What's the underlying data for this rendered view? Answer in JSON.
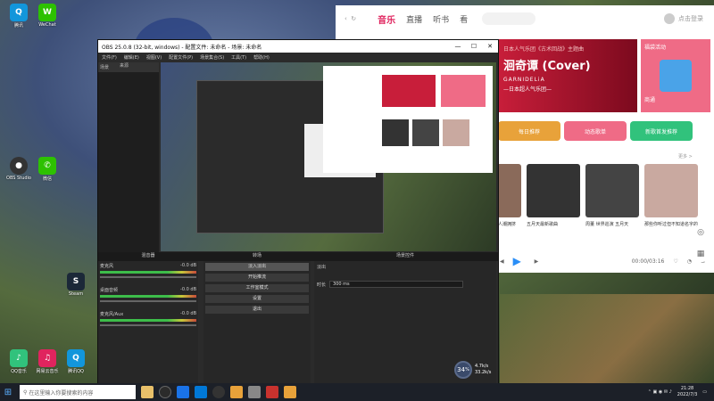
{
  "desktop": {
    "icons": [
      {
        "label": "腾讯",
        "color": "#4aa3e8",
        "glyph": "QQ"
      },
      {
        "label": "WeChat",
        "color": "#2dc100",
        "glyph": "W"
      },
      {
        "label": "OBS Studio",
        "color": "#333",
        "glyph": "●"
      },
      {
        "label": "微信",
        "color": "#2dc100",
        "glyph": "✆"
      },
      {
        "label": "Steam",
        "color": "#1b2838",
        "glyph": "S"
      },
      {
        "label": "QQ音乐",
        "color": "#31c27c",
        "glyph": "♪"
      },
      {
        "label": "网易云音乐",
        "color": "#e0245e",
        "glyph": "♫"
      },
      {
        "label": "腾讯QQ",
        "color": "#1296db",
        "glyph": "Q"
      }
    ]
  },
  "music": {
    "tabs": [
      "音乐",
      "直播",
      "听书",
      "看"
    ],
    "active_tab": "音乐",
    "user_label": "点击登录",
    "banner": {
      "t1": "日本人气乐团《古术回战》主题曲",
      "t2": "洄奇谭 (Cover)",
      "t3": "GARNIDELiA",
      "t4": "—日本超人气乐团—"
    },
    "promo_title": "福袋活动",
    "promo_sub": "商通",
    "pills": [
      {
        "label": "每日推荐",
        "color": "#e8a23a"
      },
      {
        "label": "动态歌单",
        "color": "#ef6b86"
      },
      {
        "label": "新歌首发推荐",
        "color": "#31c27c"
      }
    ],
    "more_label": "更多 >",
    "cards": [
      {
        "label": "人潮拥挤",
        "color": "#8a6a5a"
      },
      {
        "label": "五月天最新歌曲",
        "color": "#333"
      },
      {
        "label": "周董 世界巡演 五月天",
        "color": "#444"
      },
      {
        "label": "那些你听过但不知道名字的歌",
        "color": "#c9a9a0"
      }
    ],
    "player": {
      "time": "00:00/03:16"
    }
  },
  "obs": {
    "title": "OBS 25.0.8 (32-bit, windows) - 配置文件: 未命名 - 场景: 未命名",
    "menu": [
      "文件(F)",
      "编辑(E)",
      "视图(V)",
      "配置文件(P)",
      "场景集合(S)",
      "工具(T)",
      "帮助(H)"
    ],
    "scene_header": "场景",
    "source_header": "来源",
    "dock_headers": [
      "混音器",
      "转场",
      "场景控件"
    ],
    "mixer": [
      {
        "name": "麦克风",
        "db": "-0.0 dB"
      },
      {
        "name": "桌面音频",
        "db": "-0.0 dB"
      },
      {
        "name": "麦克风/Aux",
        "db": "-0.0 dB"
      }
    ],
    "transitions": [
      "淡入淡出",
      "开始推流",
      "工作室模式",
      "设置",
      "退出"
    ],
    "controls_label": "淡出",
    "duration_label": "时长",
    "duration_value": "300 ms"
  },
  "gauge": {
    "percent": "34",
    "unit": "%",
    "up": "4.7k/s",
    "down": "33.2k/s"
  },
  "taskbar": {
    "search_placeholder": "在这里输入你要搜索的内容",
    "clock_time": "21:28",
    "clock_date": "2022/7/3"
  }
}
